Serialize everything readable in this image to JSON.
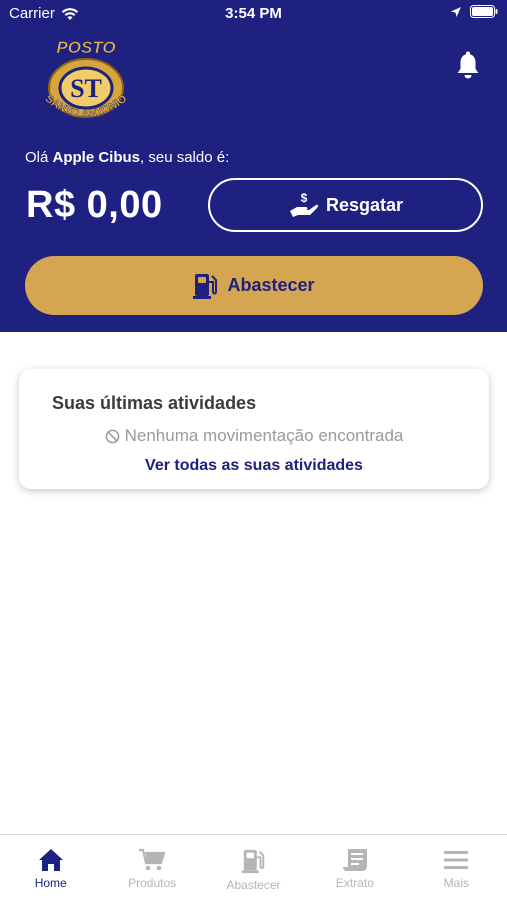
{
  "status_bar": {
    "carrier": "Carrier",
    "time": "3:54 PM"
  },
  "logo": {
    "top_text": "POSTO",
    "monogram": "ST",
    "bottom_text": "SANTO ANTONIO"
  },
  "greeting": {
    "prefix": "Olá",
    "name": "Apple Cibus",
    "suffix": ", seu saldo é:"
  },
  "balance": "R$ 0,00",
  "actions": {
    "redeem_label": "Resgatar",
    "refuel_label": "Abastecer"
  },
  "activities": {
    "title": "Suas últimas atividades",
    "empty_message": "Nenhuma movimentação encontrada",
    "view_all_link": "Ver todas as suas atividades"
  },
  "tab_bar": {
    "tabs": [
      {
        "label": "Home",
        "icon": "home-icon",
        "active": true
      },
      {
        "label": "Produtos",
        "icon": "cart-icon",
        "active": false
      },
      {
        "label": "Abastecer",
        "icon": "fuel-pump-icon",
        "active": false
      },
      {
        "label": "Extrato",
        "icon": "receipt-icon",
        "active": false
      },
      {
        "label": "Mais",
        "icon": "menu-icon",
        "active": false
      }
    ]
  },
  "colors": {
    "primary": "#1f2180",
    "accent": "#d5a552",
    "inactive": "#b5b5b5"
  }
}
